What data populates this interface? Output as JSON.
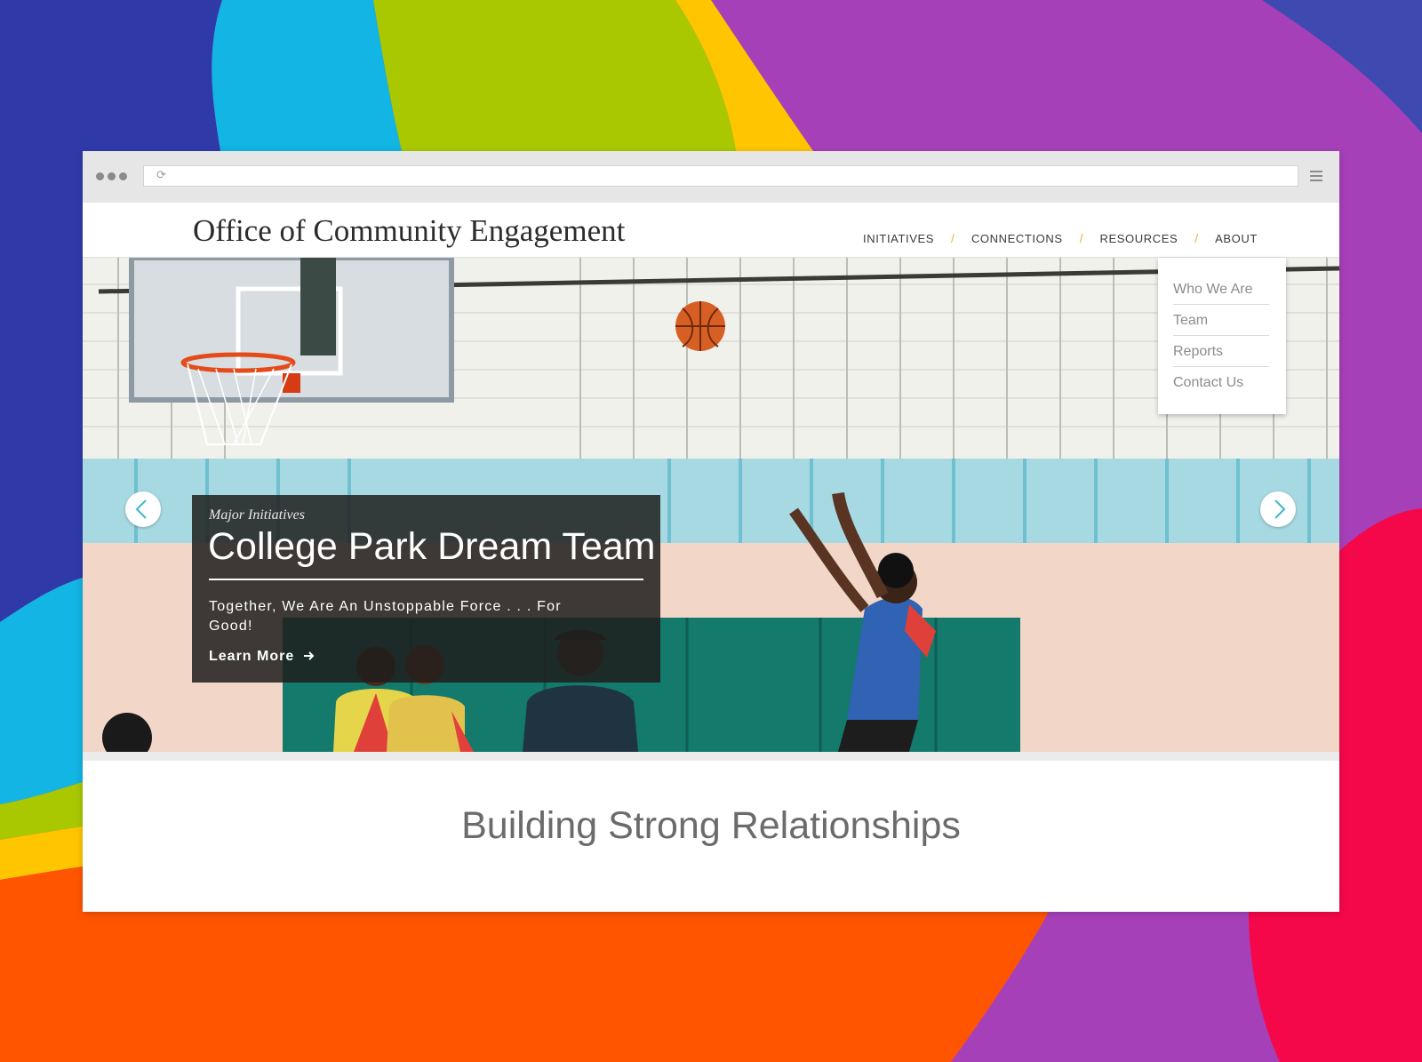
{
  "site": {
    "title": "Office of Community Engagement"
  },
  "nav": {
    "items": [
      {
        "label": "INITIATIVES"
      },
      {
        "label": "CONNECTIONS"
      },
      {
        "label": "RESOURCES"
      },
      {
        "label": "ABOUT"
      }
    ],
    "separator": "/"
  },
  "dropdown": {
    "parent": "ABOUT",
    "items": [
      {
        "label": "Who We Are"
      },
      {
        "label": "Team"
      },
      {
        "label": "Reports"
      },
      {
        "label": "Contact Us"
      }
    ]
  },
  "hero": {
    "image_subject": "basketball-gym-photo",
    "eyebrow": "Major Initiatives",
    "title": "College Park Dream Team",
    "description": "Together, We Are An Unstoppable Force . . . For Good!",
    "link_label": "Learn More",
    "prev_icon": "chevron-left-icon",
    "next_icon": "chevron-right-icon"
  },
  "section": {
    "heading": "Building Strong Relationships"
  },
  "browser": {
    "reload_glyph": "⟳"
  },
  "colors": {
    "bg_purple": "#a640b8",
    "bg_blue": "#2f3aa8",
    "bg_cyan": "#12b5e3",
    "bg_green": "#a9c800",
    "bg_yellow": "#ffc600",
    "bg_orange": "#ff5500",
    "bg_red": "#f5084a",
    "nav_separator": "#e8b33b",
    "accent_teal": "#3fb8c9"
  }
}
